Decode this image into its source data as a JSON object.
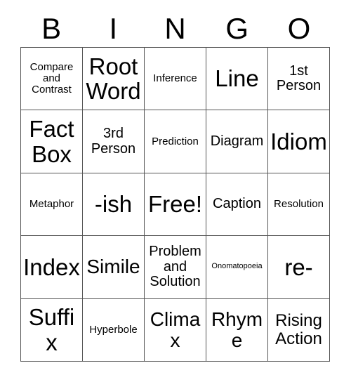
{
  "card": {
    "title": "BINGO",
    "free_space_label": "Free!",
    "header": {
      "letters": [
        "B",
        "I",
        "N",
        "G",
        "O"
      ]
    },
    "grid": {
      "rows": 5,
      "columns": 5,
      "border_color": "#555555",
      "background_color": "#ffffff",
      "text_color": "#000000",
      "cells": [
        [
          {
            "label": "Compare and Contrast",
            "size": "sm",
            "free": false
          },
          {
            "label": "Root Word",
            "size": "xxl",
            "free": false
          },
          {
            "label": "Inference",
            "size": "sm",
            "free": false
          },
          {
            "label": "Line",
            "size": "xxl",
            "free": false
          },
          {
            "label": "1st Person",
            "size": "md",
            "free": false
          }
        ],
        [
          {
            "label": "Fact Box",
            "size": "xxl",
            "free": false
          },
          {
            "label": "3rd Person",
            "size": "md",
            "free": false
          },
          {
            "label": "Prediction",
            "size": "sm",
            "free": false
          },
          {
            "label": "Diagram",
            "size": "md",
            "free": false
          },
          {
            "label": "Idiom",
            "size": "xxl",
            "free": false
          }
        ],
        [
          {
            "label": "Metaphor",
            "size": "sm",
            "free": false
          },
          {
            "label": "-ish",
            "size": "xxl",
            "free": false
          },
          {
            "label": "Free!",
            "size": "xxl",
            "free": true
          },
          {
            "label": "Caption",
            "size": "md",
            "free": false
          },
          {
            "label": "Resolution",
            "size": "sm",
            "free": false
          }
        ],
        [
          {
            "label": "Index",
            "size": "xxl",
            "free": false
          },
          {
            "label": "Simile",
            "size": "xl",
            "free": false
          },
          {
            "label": "Problem and Solution",
            "size": "md",
            "free": false
          },
          {
            "label": "Onomatopoeia",
            "size": "xs",
            "free": false
          },
          {
            "label": "re-",
            "size": "xxl",
            "free": false
          }
        ],
        [
          {
            "label": "Suffix",
            "size": "xxl",
            "free": false
          },
          {
            "label": "Hyperbole",
            "size": "sm",
            "free": false
          },
          {
            "label": "Climax",
            "size": "xl",
            "free": false
          },
          {
            "label": "Rhyme",
            "size": "xl",
            "free": false
          },
          {
            "label": "Rising Action",
            "size": "lg",
            "free": false
          }
        ]
      ]
    }
  }
}
